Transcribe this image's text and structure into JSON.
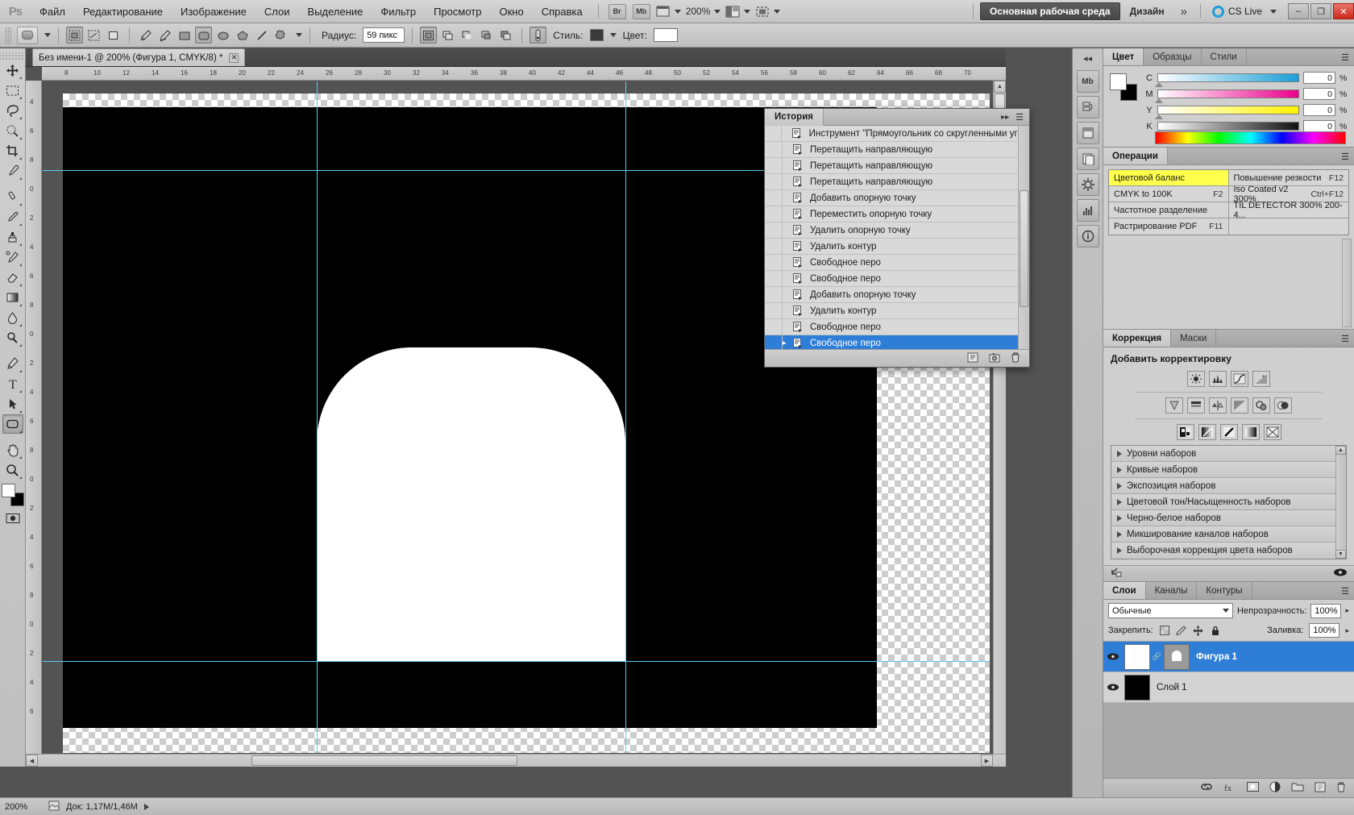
{
  "app": {
    "logo": "Ps",
    "menus": [
      "Файл",
      "Редактирование",
      "Изображение",
      "Слои",
      "Выделение",
      "Фильтр",
      "Просмотр",
      "Окно",
      "Справка"
    ],
    "bridge_label": "Br",
    "minibridge_label": "Mb",
    "zoom_level": "200%",
    "workspace_active": "Основная рабочая среда",
    "workspace_other": "Дизайн",
    "workspace_more": "»",
    "cslive_label": "CS Live",
    "window_buttons": [
      "–",
      "❐",
      "✕"
    ]
  },
  "options_bar": {
    "radius_label": "Радиус:",
    "radius_value": "59 пикс",
    "style_label": "Стиль:",
    "color_label": "Цвет:",
    "style_swatch": "#3a3a3a",
    "color_swatch": "#ffffff"
  },
  "document": {
    "tab_title": "Без имени-1 @ 200% (Фигура 1, CMYK/8) *",
    "close_glyph": "✕"
  },
  "rulers": {
    "horizontal": [
      "8",
      "10",
      "12",
      "14",
      "16",
      "18",
      "20",
      "22",
      "24",
      "26",
      "28",
      "30",
      "32",
      "34",
      "36",
      "38",
      "40",
      "42",
      "44",
      "46",
      "48",
      "50",
      "52",
      "54",
      "56",
      "58",
      "60",
      "62",
      "64",
      "66",
      "68",
      "70"
    ],
    "vertical": [
      "4",
      "6",
      "8",
      "0",
      "2",
      "4",
      "6",
      "8",
      "0",
      "2",
      "4",
      "6",
      "8",
      "0",
      "2",
      "4",
      "6",
      "8",
      "0",
      "2",
      "4",
      "6"
    ]
  },
  "history": {
    "title": "История",
    "items": [
      {
        "label": "Инструмент \"Прямоугольник со скругленными угла...",
        "selected": false
      },
      {
        "label": "Перетащить направляющую",
        "selected": false
      },
      {
        "label": "Перетащить направляющую",
        "selected": false
      },
      {
        "label": "Перетащить направляющую",
        "selected": false
      },
      {
        "label": "Добавить опорную точку",
        "selected": false
      },
      {
        "label": "Переместить опорную точку",
        "selected": false
      },
      {
        "label": "Удалить опорную точку",
        "selected": false
      },
      {
        "label": "Удалить контур",
        "selected": false
      },
      {
        "label": "Свободное перо",
        "selected": false
      },
      {
        "label": "Свободное перо",
        "selected": false
      },
      {
        "label": "Добавить опорную точку",
        "selected": false
      },
      {
        "label": "Удалить контур",
        "selected": false
      },
      {
        "label": "Свободное перо",
        "selected": false
      },
      {
        "label": "Свободное перо",
        "selected": true
      }
    ]
  },
  "color_panel": {
    "tabs": [
      "Цвет",
      "Образцы",
      "Стили"
    ],
    "active_tab": "Цвет",
    "channels": [
      {
        "name": "C",
        "value": "0",
        "unit": "%",
        "color": "#1b9fd8"
      },
      {
        "name": "M",
        "value": "0",
        "unit": "%",
        "color": "#ec008c"
      },
      {
        "name": "Y",
        "value": "0",
        "unit": "%",
        "color": "#fff200"
      },
      {
        "name": "K",
        "value": "0",
        "unit": "%",
        "color": "#111111"
      }
    ],
    "foreground": "#ffffff",
    "background": "#000000"
  },
  "operations_panel": {
    "title": "Операции",
    "rows": [
      {
        "left_label": "Цветовой баланс",
        "left_key": "",
        "left_highlight": true,
        "right_label": "Повышение резкости",
        "right_key": "F12"
      },
      {
        "left_label": "CMYK to 100K",
        "left_key": "F2",
        "left_highlight": false,
        "right_label": "Iso Coated v2 300%",
        "right_key": "Ctrl+F12"
      },
      {
        "left_label": "Частотное разделение",
        "left_key": "",
        "left_highlight": false,
        "right_label": "TIL DETECTOR 300% 200-4...",
        "right_key": ""
      },
      {
        "left_label": "Растрирование PDF",
        "left_key": "F11",
        "left_highlight": false,
        "right_label": "",
        "right_key": ""
      }
    ]
  },
  "adjustments_panel": {
    "tabs": [
      "Коррекция",
      "Маски"
    ],
    "active_tab": "Коррекция",
    "heading": "Добавить корректировку",
    "icon_row_1": [
      "brightness-contrast-icon",
      "levels-icon",
      "curves-icon",
      "exposure-icon"
    ],
    "icon_row_2": [
      "vibrance-icon",
      "hue-saturation-icon",
      "color-balance-icon",
      "black-white-icon",
      "photo-filter-icon",
      "channel-mixer-icon"
    ],
    "icon_row_3": [
      "invert-icon",
      "posterize-icon",
      "threshold-icon",
      "gradient-map-icon",
      "selective-color-icon"
    ],
    "presets": [
      "Уровни наборов",
      "Кривые наборов",
      "Экспозиция наборов",
      "Цветовой тон/Насыщенность наборов",
      "Черно-белое наборов",
      "Микширование каналов наборов",
      "Выборочная коррекция цвета наборов"
    ]
  },
  "layers_panel": {
    "tabs": [
      "Слои",
      "Каналы",
      "Контуры"
    ],
    "active_tab": "Слои",
    "blend_mode": "Обычные",
    "opacity_label": "Непрозрачность:",
    "opacity_value": "100%",
    "lock_label": "Закрепить:",
    "fill_label": "Заливка:",
    "fill_value": "100%",
    "layers": [
      {
        "name": "Фигура 1",
        "selected": true,
        "visible": true,
        "has_mask": true,
        "thumb": "#ffffff"
      },
      {
        "name": "Слой 1",
        "selected": false,
        "visible": true,
        "has_mask": false,
        "thumb": "#000000"
      }
    ]
  },
  "status_bar": {
    "zoom": "200%",
    "doc_info": "Док: 1,17M/1,46M",
    "overflow": "›››"
  },
  "toolbox": {
    "tools": [
      {
        "name": "move-tool",
        "selected": false
      },
      {
        "name": "marquee-tool",
        "selected": false
      },
      {
        "name": "lasso-tool",
        "selected": false
      },
      {
        "name": "quick-selection-tool",
        "selected": false
      },
      {
        "name": "crop-tool",
        "selected": false
      },
      {
        "name": "eyedropper-tool",
        "selected": false
      },
      {
        "name": "spot-healing-tool",
        "selected": false
      },
      {
        "name": "brush-tool",
        "selected": false
      },
      {
        "name": "clone-stamp-tool",
        "selected": false
      },
      {
        "name": "history-brush-tool",
        "selected": false
      },
      {
        "name": "eraser-tool",
        "selected": false
      },
      {
        "name": "gradient-tool",
        "selected": false
      },
      {
        "name": "blur-tool",
        "selected": false
      },
      {
        "name": "dodge-tool",
        "selected": false
      },
      {
        "name": "pen-tool",
        "selected": false
      },
      {
        "name": "type-tool",
        "selected": false
      },
      {
        "name": "path-selection-tool",
        "selected": false
      },
      {
        "name": "rounded-rectangle-tool",
        "selected": true
      },
      {
        "name": "hand-tool",
        "selected": false
      },
      {
        "name": "zoom-tool",
        "selected": false
      }
    ]
  },
  "colors": {
    "accent_selection": "#2e7dd7",
    "highlight_yellow": "#ffff4d",
    "guide_cyan": "#53d2ef",
    "canvas_bg": "#535353"
  }
}
